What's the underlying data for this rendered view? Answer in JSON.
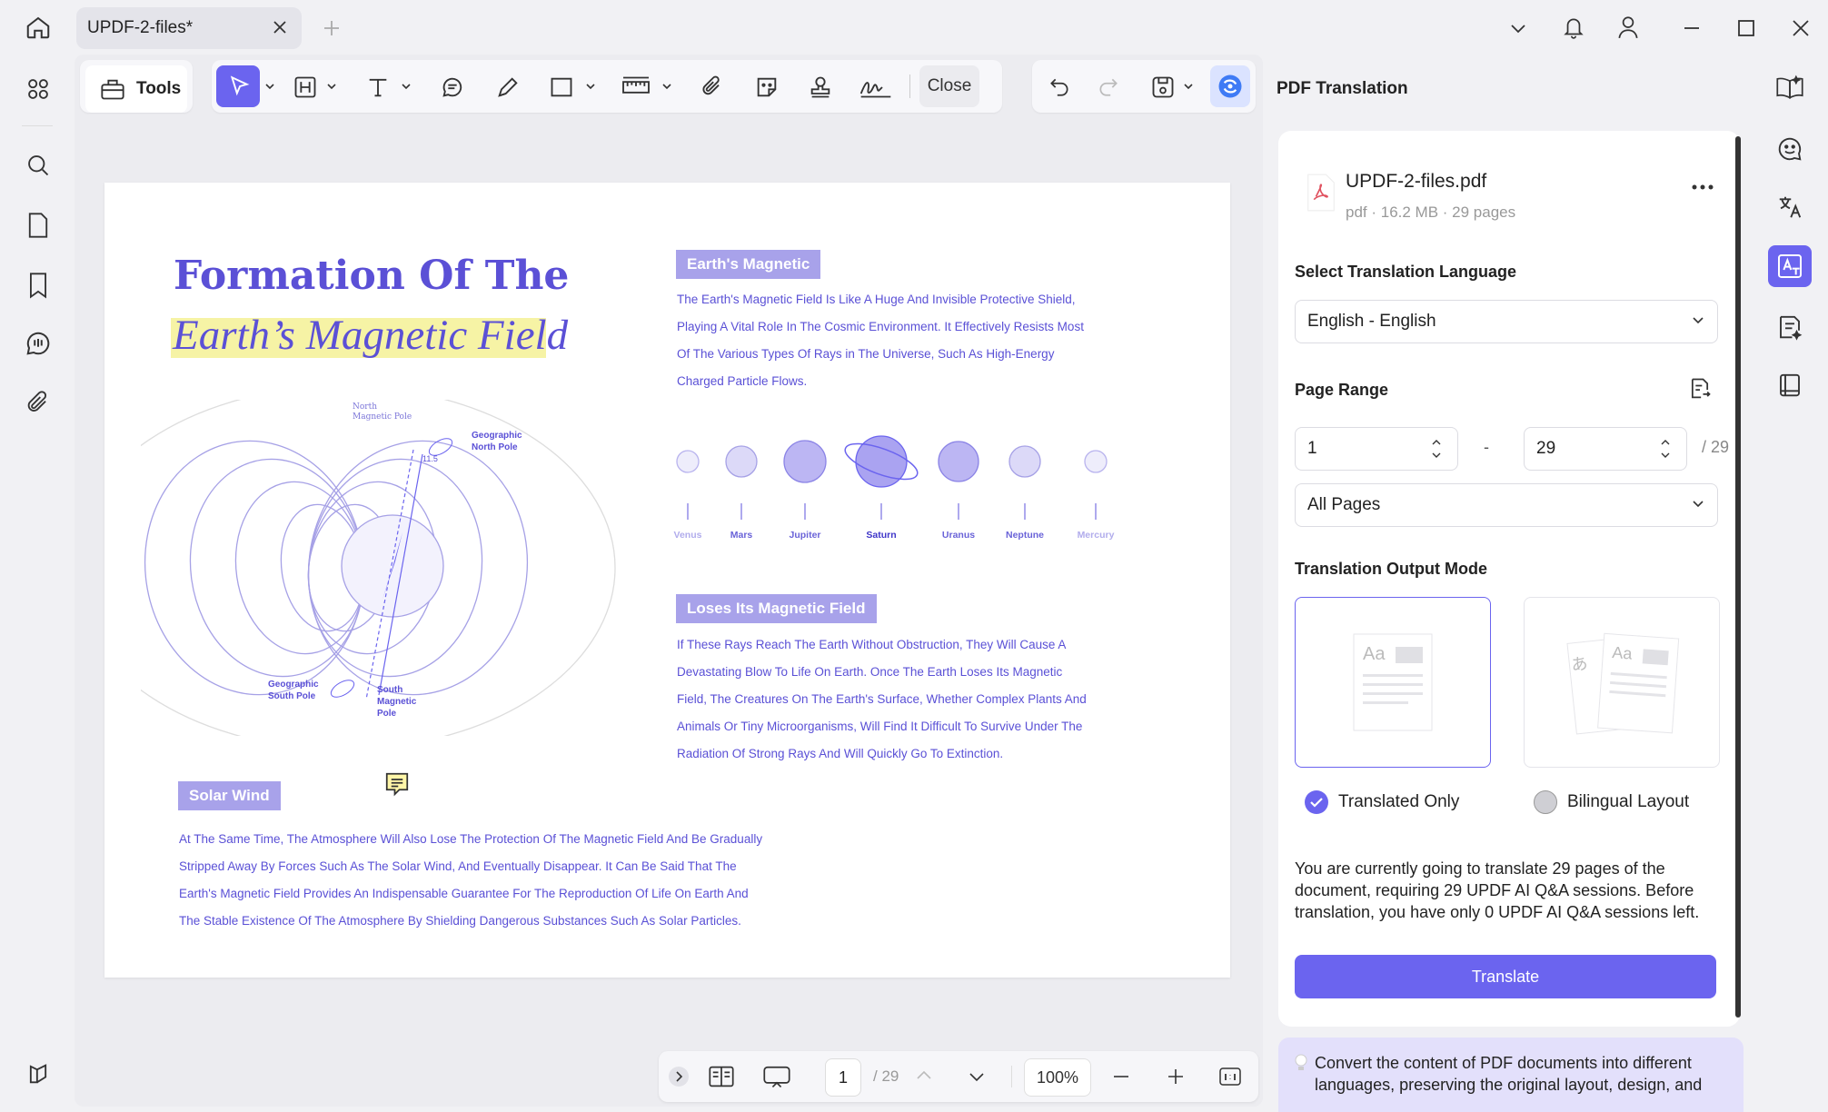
{
  "window": {
    "tab_title": "UPDF-2-files*"
  },
  "toolbar": {
    "tools_label": "Tools",
    "close_label": "Close"
  },
  "document": {
    "title_line1": "Formation Of The",
    "title_line2": "Earth’s Magnetic Field",
    "diagram_labels": {
      "north_magnetic_pole": "North Magnetic Pole",
      "geographic_north_pole": "Geographic North Pole",
      "angle": "11.5",
      "geographic_south_pole": "Geographic South Pole",
      "south_magnetic_pole": "South Magnetic Pole"
    },
    "section1_tag": "Earth's Magnetic",
    "section1_lines": [
      "The Earth's Magnetic Field Is Like A Huge And Invisible Protective Shield,",
      "Playing A Vital Role In The Cosmic Environment. It Effectively Resists Most",
      "Of The Various Types Of Rays in The Universe, Such As High-Energy",
      "Charged Particle Flows."
    ],
    "planets": [
      "Venus",
      "Mars",
      "Jupiter",
      "Saturn",
      "Uranus",
      "Neptune",
      "Mercury"
    ],
    "section2_tag": "Loses Its Magnetic Field",
    "section2_lines": [
      "If These Rays Reach The Earth Without Obstruction, They Will Cause A",
      "Devastating Blow To Life On Earth. Once The Earth Loses Its Magnetic",
      "Field, The Creatures On The Earth's Surface, Whether Complex Plants And",
      "Animals Or Tiny Microorganisms, Will Find It Difficult To Survive Under The",
      "Radiation Of Strong Rays And Will Quickly Go To Extinction."
    ],
    "section3_tag": "Solar Wind",
    "section3_lines": [
      "At The Same Time, The Atmosphere Will Also Lose The Protection Of The Magnetic Field And Be Gradually",
      "Stripped Away By Forces Such As The Solar Wind, And Eventually Disappear. It Can Be Said That The",
      "Earth's Magnetic Field Provides An Indispensable Guarantee For The Reproduction Of Life On Earth And",
      "The Stable Existence Of The Atmosphere By Shielding Dangerous Substances Such As Solar Particles."
    ]
  },
  "bottombar": {
    "current_page": "1",
    "total_pages": "/ 29",
    "zoom": "100%"
  },
  "panel": {
    "title": "PDF Translation",
    "file_name": "UPDF-2-files.pdf",
    "file_meta": "pdf · 16.2 MB · 29 pages",
    "language_label": "Select Translation Language",
    "language_value": "English - English",
    "page_range_label": "Page Range",
    "range_from": "1",
    "range_dash": "-",
    "range_to": "29",
    "range_total": "/ 29",
    "pages_option": "All Pages",
    "output_mode_label": "Translation Output Mode",
    "mode_translated": "Translated Only",
    "mode_bilingual": "Bilingual Layout",
    "note": "You are currently going to translate 29 pages of the document, requiring 29 UPDF AI Q&A sessions. Before translation, you have only 0 UPDF AI Q&A sessions left.",
    "translate_button": "Translate",
    "tip": "Convert the content of PDF documents into different languages, preserving the original layout, design, and"
  },
  "colors": {
    "accent": "#6b64ef",
    "doc_text": "#5a50d6",
    "highlight": "#f6f3a5",
    "tag_bg": "#a8a2ea"
  }
}
